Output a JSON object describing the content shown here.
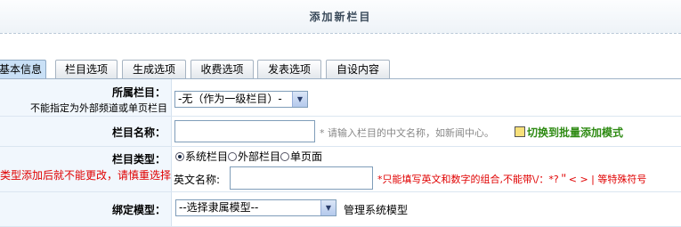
{
  "header": {
    "title": "添加新栏目"
  },
  "tabs": [
    {
      "label": "基本信息",
      "active": true
    },
    {
      "label": "栏目选项",
      "active": false
    },
    {
      "label": "生成选项",
      "active": false
    },
    {
      "label": "收费选项",
      "active": false
    },
    {
      "label": "发表选项",
      "active": false
    },
    {
      "label": "自设内容",
      "active": false
    }
  ],
  "form": {
    "parent": {
      "label": "所属栏目：",
      "note": "不能指定为外部频道或单页栏目",
      "selected": "-无（作为一级栏目）-"
    },
    "name": {
      "label": "栏目名称：",
      "value": "",
      "hint": "* 请输入栏目的中文名称，如新闻中心。",
      "batch_link": "切换到批量添加模式"
    },
    "type": {
      "label": "栏目类型：",
      "warning": "类型添加后就不能更改，请慎重选择",
      "options": [
        "系统栏目",
        "外部栏目",
        "单页面"
      ],
      "selected": "系统栏目",
      "en_label": "英文名称:",
      "en_value": "",
      "en_hint": "*只能填写英文和数字的组合,不能带\\/：*?＂< > | 等特殊符号"
    },
    "model": {
      "label": "绑定模型：",
      "selected": "--选择隶属模型--",
      "manage_link": "管理系统模型"
    }
  },
  "colors": {
    "tab_active": "#c9e0f6",
    "label_bg": "#f1f7fd",
    "warning": "#e00000",
    "link_green": "#2f8b14"
  }
}
